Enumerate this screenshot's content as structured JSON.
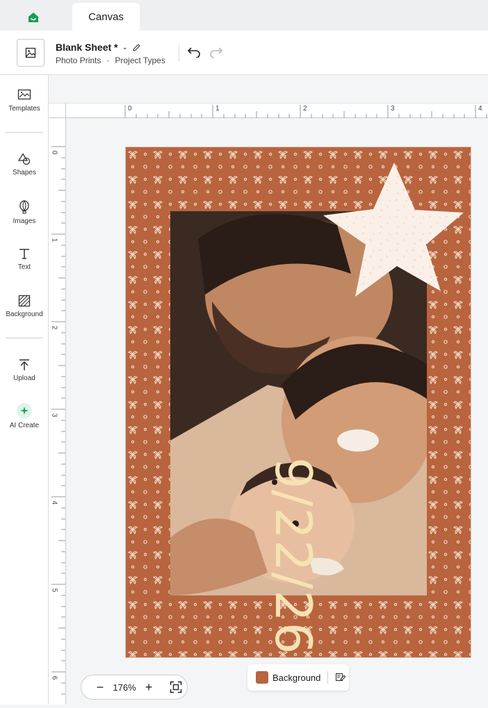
{
  "tabs": [
    {
      "label": "Canvas"
    }
  ],
  "header": {
    "title": "Blank Sheet *",
    "breadcrumb": [
      "Photo Prints",
      "Project Types"
    ]
  },
  "sidebar": {
    "items": [
      {
        "label": "Templates",
        "icon": "templates-icon"
      },
      {
        "label": "Shapes",
        "icon": "shapes-icon"
      },
      {
        "label": "Images",
        "icon": "images-icon"
      },
      {
        "label": "Text",
        "icon": "text-icon"
      },
      {
        "label": "Background",
        "icon": "background-icon"
      },
      {
        "label": "Upload",
        "icon": "upload-icon"
      },
      {
        "label": "AI Create",
        "icon": "sparkle-icon"
      }
    ]
  },
  "ruler": {
    "top_numbers": [
      "0",
      "1",
      "2",
      "3",
      "4"
    ],
    "left_numbers": [
      "0",
      "1",
      "2",
      "3",
      "4",
      "5",
      "6"
    ]
  },
  "design": {
    "date_text": "9/22/26",
    "background_color": "#b8643f",
    "pattern_color": "#f1d9c0",
    "star_color": "#fbf0e8",
    "text_color": "#f6e2b3"
  },
  "zoom": {
    "minus": "−",
    "value": "176%",
    "plus": "+"
  },
  "layer": {
    "label": "Background"
  }
}
